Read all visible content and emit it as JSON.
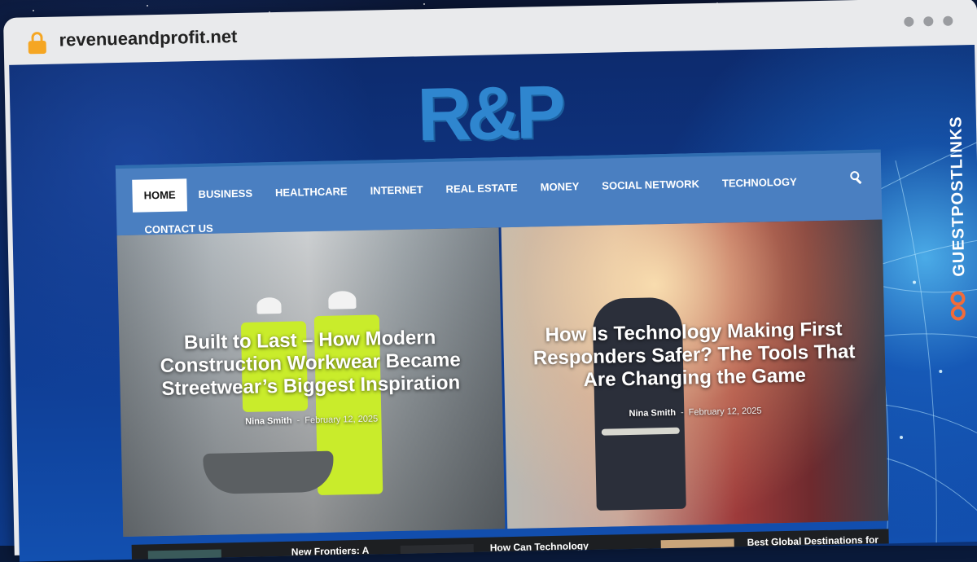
{
  "browser": {
    "url": "revenueandprofit.net"
  },
  "site": {
    "logo_text": "R&P",
    "nav": {
      "items": [
        {
          "label": "HOME",
          "active": true
        },
        {
          "label": "BUSINESS",
          "active": false
        },
        {
          "label": "HEALTHCARE",
          "active": false
        },
        {
          "label": "INTERNET",
          "active": false
        },
        {
          "label": "REAL ESTATE",
          "active": false
        },
        {
          "label": "MONEY",
          "active": false
        },
        {
          "label": "SOCIAL NETWORK",
          "active": false
        },
        {
          "label": "TECHNOLOGY",
          "active": false
        },
        {
          "label": "CONTACT US",
          "active": false
        }
      ],
      "search_icon": "search-icon"
    },
    "hero": [
      {
        "title": "Built to Last – How Modern Construction Workwear Became Streetwear’s Biggest Inspiration",
        "author": "Nina Smith",
        "separator": "-",
        "date": "February 12, 2025"
      },
      {
        "title": "How Is Technology Making First Responders Safer? The Tools That Are Changing the Game",
        "author": "Nina Smith",
        "separator": "-",
        "date": "February 12, 2025"
      }
    ],
    "strip": [
      {
        "title": "New Frontiers: A"
      },
      {
        "title": "How Can Technology"
      },
      {
        "title": "Best Global Destinations for"
      }
    ]
  },
  "brand": {
    "text": "GUESTPOSTLINKS"
  },
  "colors": {
    "nav_bg": "#4a7fc1",
    "logo": "#2f86cf",
    "lock": "#f5a623",
    "brand_accent": "#f26b3a"
  }
}
